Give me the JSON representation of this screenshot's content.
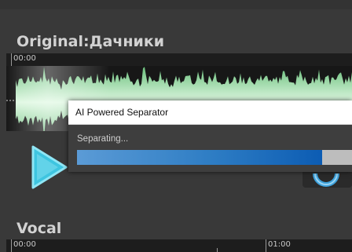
{
  "tracks": {
    "original": {
      "title": "Original:Дачники",
      "timeline_labels": [
        "00:00"
      ]
    },
    "vocal": {
      "title": "Vocal",
      "timeline_labels": [
        "00:00",
        "01:00"
      ]
    }
  },
  "waveform": {
    "color": "#7fd08f",
    "highlight_color": "#c9f5cf",
    "background": "#171717"
  },
  "controls": {
    "play_icon": "play-icon",
    "play_color": "#3ec5e0",
    "reload_icon": "refresh-icon"
  },
  "dialog": {
    "title": "AI Powered Separator",
    "status": "Separating...",
    "progress": 0.89
  }
}
